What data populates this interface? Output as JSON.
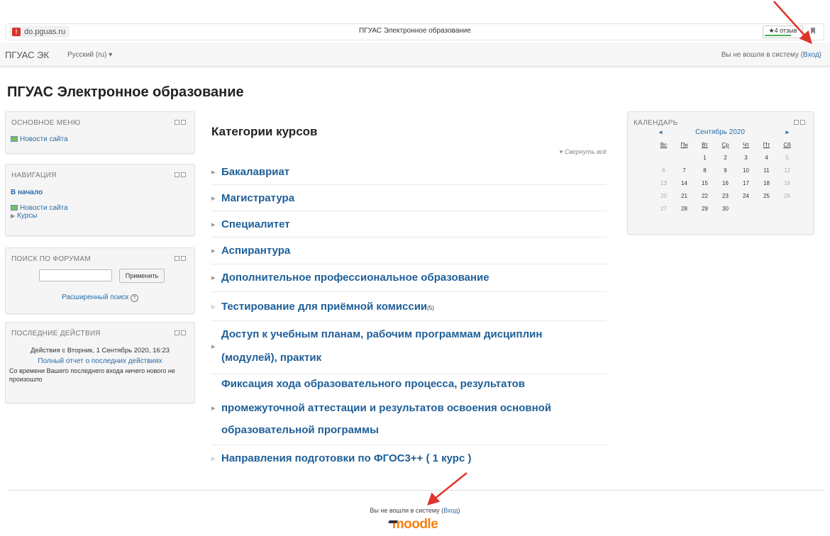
{
  "browser": {
    "url": "do.pguas.ru",
    "tab_title": "ПГУАС Электронное образование",
    "reviews": "★4 отзыв"
  },
  "navbar": {
    "brand": "ПГУАС ЭК",
    "language": "Русский (ru) ▾",
    "login_status": "Вы не вошли в систему (",
    "login_link": "Вход",
    "login_close": ")"
  },
  "page_title": "ПГУАС Электронное образование",
  "main_menu": {
    "title": "ОСНОВНОЕ МЕНЮ",
    "items": [
      "Новости сайта"
    ]
  },
  "navigation": {
    "title": "НАВИГАЦИЯ",
    "home": "В начало",
    "news": "Новости сайта",
    "courses": "Курсы"
  },
  "forum_search": {
    "title": "ПОИСК ПО ФОРУМАМ",
    "input_value": "",
    "button": "Применить",
    "advanced": "Расширенный поиск"
  },
  "recent_activity": {
    "title": "ПОСЛЕДНИЕ ДЕЙСТВИЯ",
    "since": "Действия с Вторник, 1 Сентябрь 2020, 16:23",
    "full_report": "Полный отчет о последних действиях",
    "message": "Со времени Вашего последнего входа ничего нового не произошло"
  },
  "categories": {
    "heading": "Категории курсов",
    "collapse_all": "Свернуть всё",
    "items": [
      {
        "name": "Бакалавриат",
        "count": ""
      },
      {
        "name": "Магистратура",
        "count": ""
      },
      {
        "name": "Специалитет",
        "count": ""
      },
      {
        "name": "Аспирантура",
        "count": ""
      },
      {
        "name": "Дополнительное профессиональное образование",
        "count": ""
      },
      {
        "name": "Тестирование для приёмной комиссии",
        "count": "(5)"
      },
      {
        "name_line1": "Доступ к учебным планам, рабочим программам дисциплин",
        "name_line2": "(модулей), практик"
      },
      {
        "name_line1": "Фиксация хода образовательного процесса, результатов",
        "name_line2": "промежуточной аттестации и результатов освоения основной",
        "name_line3": "образовательной программы"
      },
      {
        "name": "Направления подготовки по ФГОС3++ ( 1 курс )",
        "count": ""
      }
    ]
  },
  "calendar": {
    "title": "КАЛЕНДАРЬ",
    "month": "Сентябрь 2020",
    "prev": "◄",
    "next": "►",
    "weekdays": [
      "Вс",
      "Пн",
      "Вт",
      "Ср",
      "Чт",
      "Пт",
      "Сб"
    ],
    "weeks": [
      [
        "",
        "",
        "1",
        "2",
        "3",
        "4",
        "5"
      ],
      [
        "6",
        "7",
        "8",
        "9",
        "10",
        "11",
        "12"
      ],
      [
        "13",
        "14",
        "15",
        "16",
        "17",
        "18",
        "19"
      ],
      [
        "20",
        "21",
        "22",
        "23",
        "24",
        "25",
        "26"
      ],
      [
        "27",
        "28",
        "29",
        "30",
        "",
        "",
        ""
      ]
    ]
  },
  "footer": {
    "login_status": "Вы не вошли в систему (",
    "login_link": "Вход",
    "login_close": ")",
    "logo": "moodle"
  },
  "colors": {
    "link": "#2a6ca8",
    "category": "#1e5f99",
    "annotation_arrow": "#e0342b",
    "moodle_orange": "#f98012"
  }
}
